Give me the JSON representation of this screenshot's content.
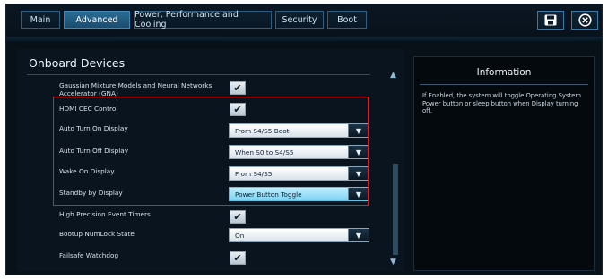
{
  "tabs": [
    {
      "label": "Main",
      "active": false
    },
    {
      "label": "Advanced",
      "active": true
    },
    {
      "label": "Power, Performance and Cooling",
      "active": false
    },
    {
      "label": "Security",
      "active": false
    },
    {
      "label": "Boot",
      "active": false
    }
  ],
  "toolbar": {
    "save_icon": "floppy-disk-icon",
    "close_icon": "close-circle-icon"
  },
  "panel": {
    "title": "Onboard Devices",
    "items": [
      {
        "label": "Gaussian Mixture Models and Neural Networks\nAccelerator (GNA)",
        "type": "checkbox",
        "checked": true
      },
      {
        "label": "HDMI CEC Control",
        "type": "checkbox",
        "checked": true
      },
      {
        "label": "Auto Turn On Display",
        "type": "select",
        "value": "From S4/S5 Boot"
      },
      {
        "label": "Auto Turn Off Display",
        "type": "select",
        "value": "When S0 to S4/S5"
      },
      {
        "label": "Wake On Display",
        "type": "select",
        "value": "From S4/S5"
      },
      {
        "label": "Standby by Display",
        "type": "select",
        "value": "Power Button Toggle"
      },
      {
        "label": "High Precision Event Timers",
        "type": "checkbox",
        "checked": true
      },
      {
        "label": "Bootup NumLock State",
        "type": "select",
        "value": "On"
      },
      {
        "label": "Failsafe Watchdog",
        "type": "checkbox",
        "checked": true
      }
    ]
  },
  "info": {
    "title": "Information",
    "text": "If Enabled, the system will toggle Operating System Power button or sleep button when Display turning off."
  },
  "colors": {
    "accent": "#2a6c95",
    "highlight_box": "#e01f25",
    "selected_field": "#7fd2f0"
  }
}
